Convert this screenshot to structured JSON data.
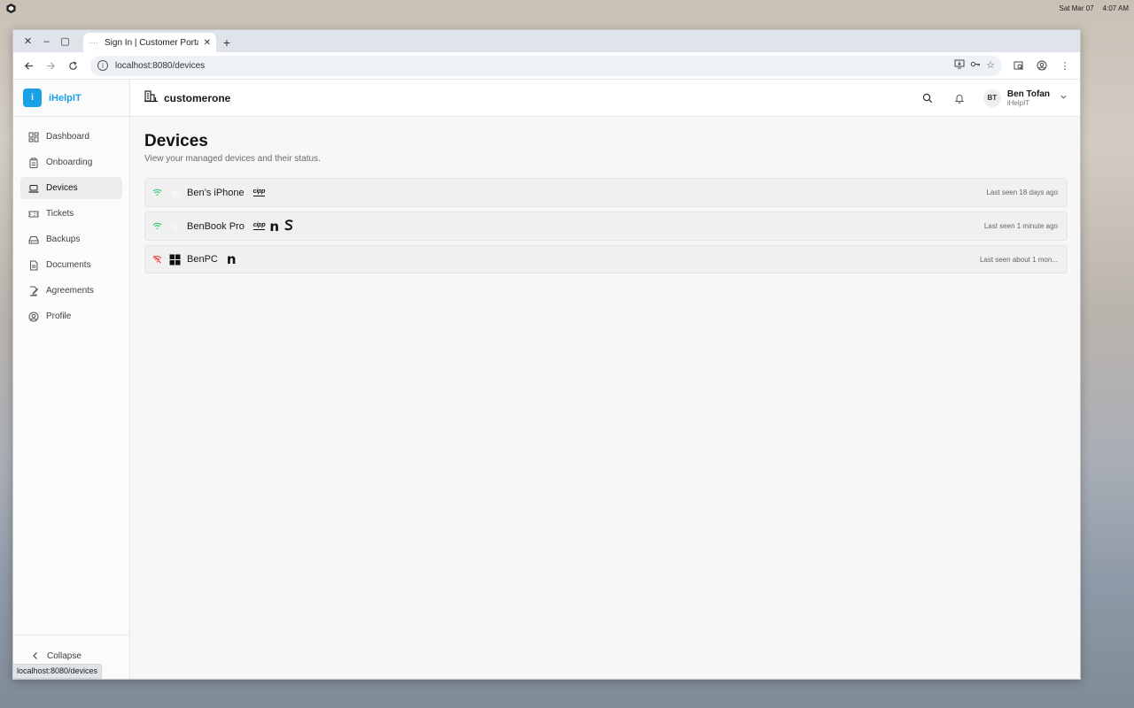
{
  "system": {
    "date": "Sat Mar 07",
    "time": "4:07 AM"
  },
  "browser": {
    "tab_title": "Sign In | Customer Portal",
    "tab_favicon": "····",
    "url": "localhost:8080/devices",
    "status_url": "localhost:8080/devices"
  },
  "brand": {
    "badge": "i",
    "name": "iHelpIT",
    "color": "#1aa0e6"
  },
  "sidebar": {
    "items": [
      {
        "label": "Dashboard",
        "icon": "dashboard-icon"
      },
      {
        "label": "Onboarding",
        "icon": "clipboard-icon"
      },
      {
        "label": "Devices",
        "icon": "laptop-icon",
        "active": true
      },
      {
        "label": "Tickets",
        "icon": "ticket-icon"
      },
      {
        "label": "Backups",
        "icon": "hard-drive-icon"
      },
      {
        "label": "Documents",
        "icon": "document-icon"
      },
      {
        "label": "Agreements",
        "icon": "signature-icon"
      },
      {
        "label": "Profile",
        "icon": "user-circle-icon"
      }
    ],
    "collapse_label": "Collapse"
  },
  "topbar": {
    "org_name": "customerone",
    "user": {
      "initials": "BT",
      "name": "Ben Tofan",
      "org": "iHelpIT"
    }
  },
  "page": {
    "title": "Devices",
    "subtitle": "View your managed devices and their status."
  },
  "devices": [
    {
      "name": "Ben’s iPhone",
      "online": true,
      "os": "apple",
      "tags": [
        "cipp"
      ],
      "last_seen": "Last seen 18 days ago"
    },
    {
      "name": "BenBook Pro",
      "online": true,
      "os": "apple",
      "tags": [
        "cipp",
        "ninja",
        "s"
      ],
      "last_seen": "Last seen 1 minute ago"
    },
    {
      "name": "BenPC",
      "online": false,
      "os": "windows",
      "tags": [
        "ninja"
      ],
      "last_seen": "Last seen about 1 mon..."
    }
  ],
  "tag_labels": {
    "cipp": "cipp",
    "ninja": "n",
    "s": "S"
  },
  "colors": {
    "online": "#22c55e",
    "offline": "#ef4444"
  }
}
